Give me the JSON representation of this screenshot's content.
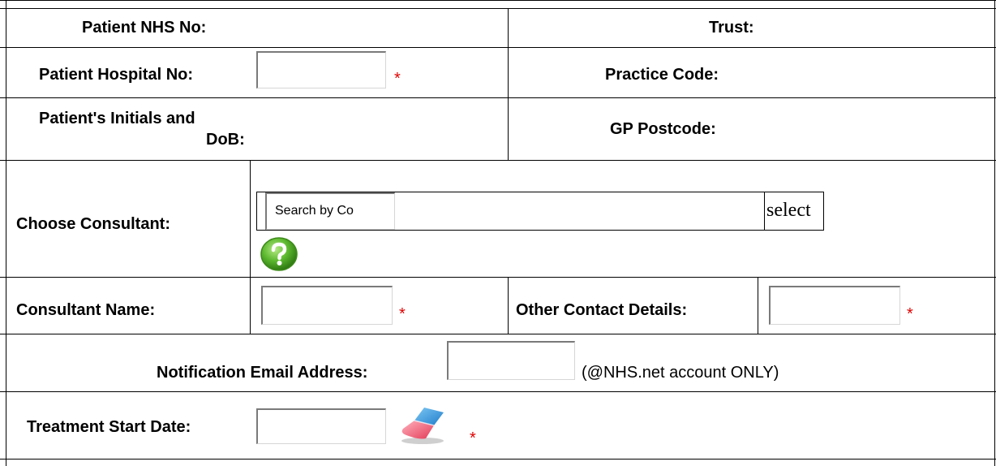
{
  "form": {
    "nhs_no_label": "Patient NHS No:",
    "trust_label": "Trust:",
    "hospital_no_label": "Patient Hospital No:",
    "practice_code_label": "Practice Code:",
    "initials_dob_label_line1": "Patient's Initials and",
    "initials_dob_label_line2": "DoB:",
    "gp_postcode_label": "GP Postcode:",
    "choose_consultant_label": "Choose Consultant:",
    "search_placeholder": "Search by Co",
    "select_label": "select",
    "consultant_name_label": "Consultant Name:",
    "other_contact_label": "Other Contact Details:",
    "notification_email_label": "Notification Email Address:",
    "notification_email_note": "(@NHS.net account ONLY)",
    "treatment_start_label": "Treatment Start Date:",
    "required_marker": "*"
  },
  "icons": {
    "help": "help-icon",
    "eraser": "eraser-icon"
  },
  "colors": {
    "required": "#e00000",
    "help_green": "#5cb82e"
  }
}
